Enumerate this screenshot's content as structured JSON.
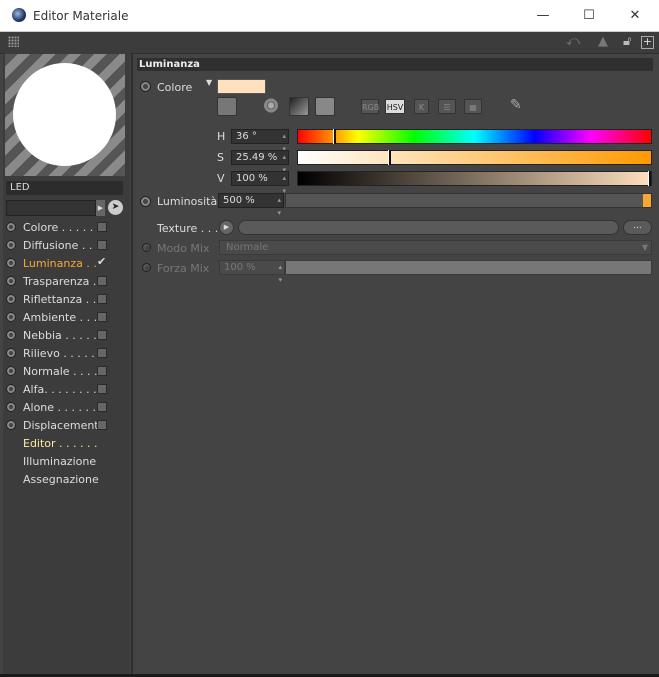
{
  "window": {
    "title": "Editor Materiale",
    "minimize_glyph": "—",
    "maximize_glyph": "☐",
    "close_glyph": "✕"
  },
  "toolbar": {
    "icons": [
      "grip-icon",
      "arrow-back-icon",
      "arrow-up-icon",
      "lock-icon",
      "new-panel-icon"
    ]
  },
  "material": {
    "name": "LED"
  },
  "channels": [
    {
      "label": "Colore . . . . .",
      "checked": false,
      "active": false
    },
    {
      "label": "Diffusione . .",
      "checked": false,
      "active": false
    },
    {
      "label": "Luminanza . .",
      "checked": true,
      "active": true
    },
    {
      "label": "Trasparenza . .",
      "checked": false,
      "active": false
    },
    {
      "label": "Riflettanza . .",
      "checked": false,
      "active": false
    },
    {
      "label": "Ambiente . . . .",
      "checked": false,
      "active": false
    },
    {
      "label": "Nebbia . . . . .",
      "checked": false,
      "active": false
    },
    {
      "label": "Rilievo . . . . .",
      "checked": false,
      "active": false
    },
    {
      "label": "Normale . . . .",
      "checked": false,
      "active": false
    },
    {
      "label": "Alfa. . . . . . . .",
      "checked": false,
      "active": false
    },
    {
      "label": "Alone . . . . . .",
      "checked": false,
      "active": false
    },
    {
      "label": "Displacement",
      "checked": false,
      "active": false
    }
  ],
  "extra_pages": [
    "Editor . . . . . .",
    "Illuminazione",
    "Assegnazione"
  ],
  "section": {
    "title": "Luminanza",
    "color_label": "Colore",
    "swatch_color": "#ffe0bf",
    "mode_buttons": [
      "RGB",
      "HSV",
      "K"
    ],
    "selected_mode": "HSV",
    "h": {
      "label": "H",
      "value": "36 °",
      "fraction": 0.1
    },
    "s": {
      "label": "S",
      "value": "25.49 %",
      "fraction": 0.2549
    },
    "v": {
      "label": "V",
      "value": "100 %",
      "fraction": 1.0
    },
    "luminosity": {
      "label": "Luminosità",
      "value": "500 %",
      "fraction": 1.0
    },
    "texture": {
      "label": "Texture . . .",
      "browse": "..."
    },
    "mix_mode": {
      "label": "Modo Mix",
      "value": "Normale"
    },
    "mix_strength": {
      "label": "Forza Mix",
      "value": "100 %"
    }
  },
  "colors": {
    "accent": "#f8a832",
    "panel": "#444444"
  }
}
